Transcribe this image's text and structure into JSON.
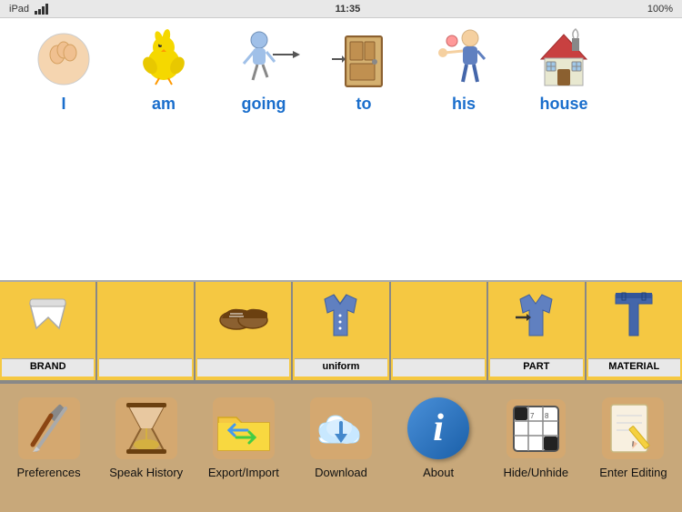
{
  "statusBar": {
    "left": "iPad",
    "time": "11:35",
    "battery": "100%"
  },
  "sentence": {
    "words": [
      {
        "id": "I",
        "label": "I",
        "icon": "🤌"
      },
      {
        "id": "am",
        "label": "am",
        "icon": "🐣"
      },
      {
        "id": "going",
        "label": "going",
        "icon": "🚶"
      },
      {
        "id": "to",
        "label": "to",
        "icon": "🚪"
      },
      {
        "id": "his",
        "label": "his",
        "icon": "👦"
      },
      {
        "id": "house",
        "label": "house",
        "icon": "🏠"
      }
    ]
  },
  "categories": [
    {
      "id": "brand",
      "label": "BRAND",
      "icon": "👙",
      "sublabel": ""
    },
    {
      "id": "empty1",
      "label": "",
      "icon": "",
      "sublabel": ""
    },
    {
      "id": "shoes",
      "label": "",
      "icon": "👞",
      "sublabel": ""
    },
    {
      "id": "uniform",
      "label": "uniform",
      "icon": "👔",
      "sublabel": ""
    },
    {
      "id": "empty2",
      "label": "",
      "icon": "",
      "sublabel": ""
    },
    {
      "id": "part",
      "label": "PART",
      "icon": "👔",
      "sublabel": "→"
    },
    {
      "id": "material",
      "label": "MATERIAL",
      "icon": "👖",
      "sublabel": ""
    }
  ],
  "toolbar": {
    "buttons": [
      {
        "id": "preferences",
        "label": "Preferences",
        "icon": "🔧"
      },
      {
        "id": "speak-history",
        "label": "Speak History",
        "icon": "⏳"
      },
      {
        "id": "export-import",
        "label": "Export/Import",
        "icon": "📁"
      },
      {
        "id": "download",
        "label": "Download",
        "icon": "☁️"
      },
      {
        "id": "about",
        "label": "About",
        "icon": "ℹ️"
      },
      {
        "id": "hide-unhide",
        "label": "Hide/Unhide",
        "icon": "🔲"
      },
      {
        "id": "enter-editing",
        "label": "Enter Editing",
        "icon": "📝"
      }
    ]
  }
}
